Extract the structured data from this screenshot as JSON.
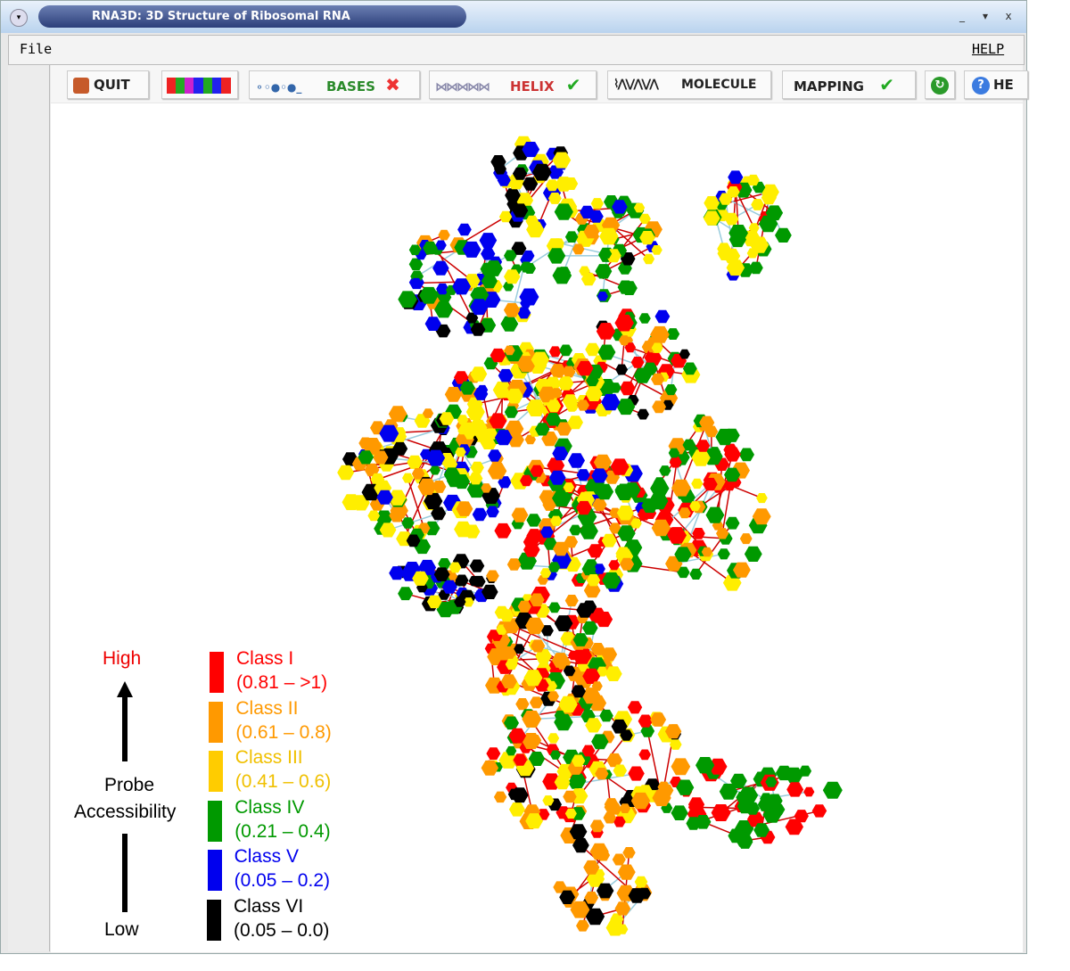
{
  "window": {
    "title": "RNA3D: 3D Structure of Ribosomal RNA",
    "minimize": "_",
    "maximize": "▾",
    "close": "x"
  },
  "menu": {
    "file": "File",
    "help": "HELP"
  },
  "toolbar": {
    "quit": "QUIT",
    "bases": "BASES",
    "helix": "HELIX",
    "molecule": "MOLECULE",
    "mapping": "MAPPING",
    "help": "HE"
  },
  "legend": {
    "high": "High",
    "low": "Low",
    "axis_label_1": "Probe",
    "axis_label_2": "Accessibility",
    "classes": [
      {
        "name": "Class  I",
        "range": "(0.81 – >1)",
        "color": "#ff0000"
      },
      {
        "name": "Class  II",
        "range": "(0.61 – 0.8)",
        "color": "#ff9900"
      },
      {
        "name": "Class  III",
        "range": "(0.41 – 0.6)",
        "color": "#ffcc00"
      },
      {
        "name": "Class  IV",
        "range": "(0.21 – 0.4)",
        "color": "#009900"
      },
      {
        "name": "Class  V",
        "range": "(0.05 – 0.2)",
        "color": "#0000ee"
      },
      {
        "name": "Class  VI",
        "range": "(0.05 – 0.0)",
        "color": "#000000"
      }
    ]
  }
}
